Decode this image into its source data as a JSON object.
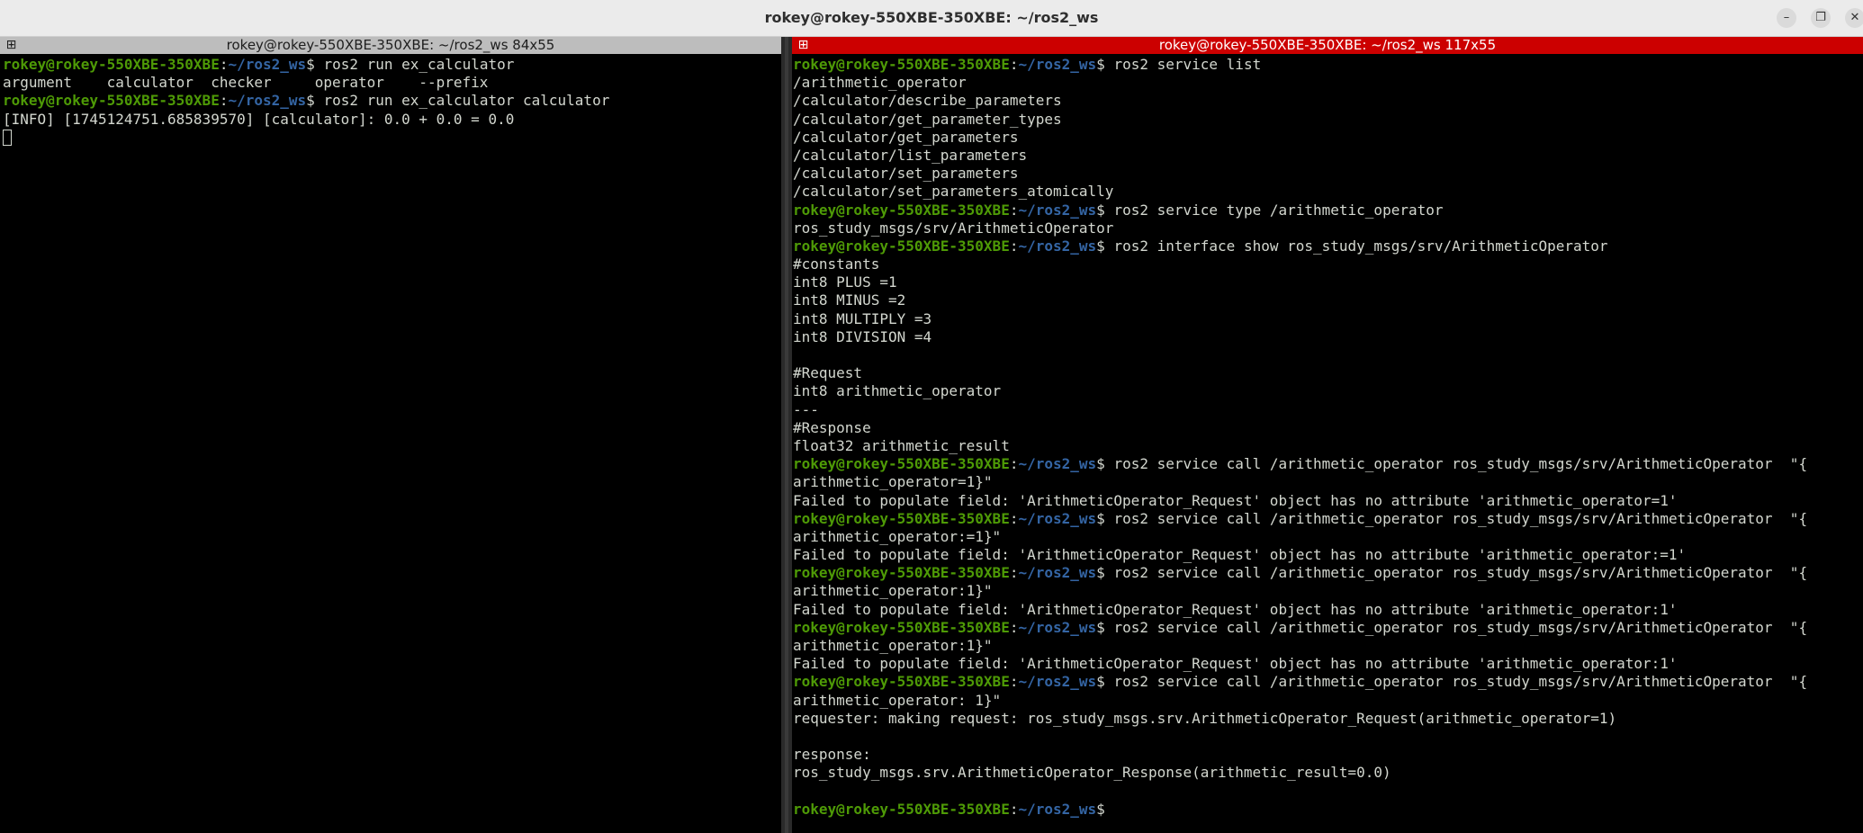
{
  "window": {
    "title": "rokey@rokey-550XBE-350XBE: ~/ros2_ws",
    "controls": {
      "minimize": "–",
      "maximize": "❐",
      "close": "✕"
    }
  },
  "prompt": {
    "user": "rokey@rokey-550XBE-350XBE",
    "sep": ":",
    "path": "~/ros2_ws",
    "sign": "$"
  },
  "left_terminal": {
    "title": "rokey@rokey-550XBE-350XBE: ~/ros2_ws 84x55",
    "lines": [
      {
        "prompt": true,
        "text": " ros2 run ex_calculator"
      },
      {
        "prompt": false,
        "text": "argument    calculator  checker     operator    --prefix"
      },
      {
        "prompt": true,
        "text": " ros2 run ex_calculator calculator"
      },
      {
        "prompt": false,
        "text": "[INFO] [1745124751.685839570] [calculator]: 0.0 + 0.0 = 0.0"
      }
    ]
  },
  "right_terminal": {
    "title": "rokey@rokey-550XBE-350XBE: ~/ros2_ws 117x55",
    "lines": [
      {
        "prompt": true,
        "text": " ros2 service list"
      },
      {
        "prompt": false,
        "text": "/arithmetic_operator"
      },
      {
        "prompt": false,
        "text": "/calculator/describe_parameters"
      },
      {
        "prompt": false,
        "text": "/calculator/get_parameter_types"
      },
      {
        "prompt": false,
        "text": "/calculator/get_parameters"
      },
      {
        "prompt": false,
        "text": "/calculator/list_parameters"
      },
      {
        "prompt": false,
        "text": "/calculator/set_parameters"
      },
      {
        "prompt": false,
        "text": "/calculator/set_parameters_atomically"
      },
      {
        "prompt": true,
        "text": " ros2 service type /arithmetic_operator"
      },
      {
        "prompt": false,
        "text": "ros_study_msgs/srv/ArithmeticOperator"
      },
      {
        "prompt": true,
        "text": " ros2 interface show ros_study_msgs/srv/ArithmeticOperator"
      },
      {
        "prompt": false,
        "text": "#constants"
      },
      {
        "prompt": false,
        "text": "int8 PLUS =1"
      },
      {
        "prompt": false,
        "text": "int8 MINUS =2"
      },
      {
        "prompt": false,
        "text": "int8 MULTIPLY =3"
      },
      {
        "prompt": false,
        "text": "int8 DIVISION =4"
      },
      {
        "prompt": false,
        "text": ""
      },
      {
        "prompt": false,
        "text": "#Request"
      },
      {
        "prompt": false,
        "text": "int8 arithmetic_operator"
      },
      {
        "prompt": false,
        "text": "---"
      },
      {
        "prompt": false,
        "text": "#Response"
      },
      {
        "prompt": false,
        "text": "float32 arithmetic_result"
      },
      {
        "prompt": true,
        "text": " ros2 service call /arithmetic_operator ros_study_msgs/srv/ArithmeticOperator  \"{"
      },
      {
        "prompt": false,
        "text": "arithmetic_operator=1}\""
      },
      {
        "prompt": false,
        "text": "Failed to populate field: 'ArithmeticOperator_Request' object has no attribute 'arithmetic_operator=1'"
      },
      {
        "prompt": true,
        "text": " ros2 service call /arithmetic_operator ros_study_msgs/srv/ArithmeticOperator  \"{"
      },
      {
        "prompt": false,
        "text": "arithmetic_operator:=1}\""
      },
      {
        "prompt": false,
        "text": "Failed to populate field: 'ArithmeticOperator_Request' object has no attribute 'arithmetic_operator:=1'"
      },
      {
        "prompt": true,
        "text": " ros2 service call /arithmetic_operator ros_study_msgs/srv/ArithmeticOperator  \"{"
      },
      {
        "prompt": false,
        "text": "arithmetic_operator:1}\""
      },
      {
        "prompt": false,
        "text": "Failed to populate field: 'ArithmeticOperator_Request' object has no attribute 'arithmetic_operator:1'"
      },
      {
        "prompt": true,
        "text": " ros2 service call /arithmetic_operator ros_study_msgs/srv/ArithmeticOperator  \"{"
      },
      {
        "prompt": false,
        "text": "arithmetic_operator:1}\""
      },
      {
        "prompt": false,
        "text": "Failed to populate field: 'ArithmeticOperator_Request' object has no attribute 'arithmetic_operator:1'"
      },
      {
        "prompt": true,
        "text": " ros2 service call /arithmetic_operator ros_study_msgs/srv/ArithmeticOperator  \"{"
      },
      {
        "prompt": false,
        "text": "arithmetic_operator: 1}\""
      },
      {
        "prompt": false,
        "text": "requester: making request: ros_study_msgs.srv.ArithmeticOperator_Request(arithmetic_operator=1)"
      },
      {
        "prompt": false,
        "text": ""
      },
      {
        "prompt": false,
        "text": "response:"
      },
      {
        "prompt": false,
        "text": "ros_study_msgs.srv.ArithmeticOperator_Response(arithmetic_result=0.0)"
      },
      {
        "prompt": false,
        "text": ""
      },
      {
        "prompt": true,
        "text": ""
      }
    ]
  },
  "colors": {
    "user": "#4e9a06",
    "path": "#3465a4",
    "text": "#d3d7cf",
    "active_title": "#cc0000"
  }
}
